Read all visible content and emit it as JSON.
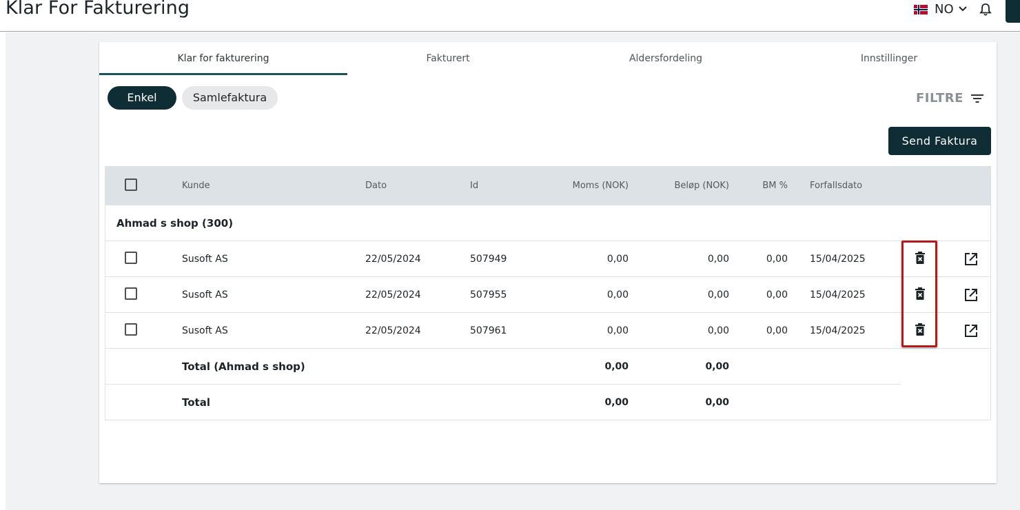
{
  "header": {
    "title": "Klar For Fakturering",
    "language_code": "NO",
    "language_flag": "norway-flag"
  },
  "tabs": [
    {
      "label": "Klar for fakturering",
      "active": true
    },
    {
      "label": "Fakturert",
      "active": false
    },
    {
      "label": "Aldersfordeling",
      "active": false
    },
    {
      "label": "Innstillinger",
      "active": false
    }
  ],
  "mode_toggle": {
    "options": [
      "Enkel",
      "Samlefaktura"
    ],
    "selected": "Enkel"
  },
  "filter": {
    "label": "FILTRE"
  },
  "actions": {
    "send_label": "Send Faktura"
  },
  "table": {
    "columns": [
      "Kunde",
      "Dato",
      "Id",
      "Moms (NOK)",
      "Beløp (NOK)",
      "BM %",
      "Forfallsdato"
    ],
    "group": {
      "title": "Ahmad s shop (300)",
      "rows": [
        {
          "kunde": "Susoft AS",
          "dato": "22/05/2024",
          "id": "507949",
          "moms": "0,00",
          "belop": "0,00",
          "bm": "0,00",
          "forfall": "15/04/2025"
        },
        {
          "kunde": "Susoft AS",
          "dato": "22/05/2024",
          "id": "507955",
          "moms": "0,00",
          "belop": "0,00",
          "bm": "0,00",
          "forfall": "15/04/2025"
        },
        {
          "kunde": "Susoft AS",
          "dato": "22/05/2024",
          "id": "507961",
          "moms": "0,00",
          "belop": "0,00",
          "bm": "0,00",
          "forfall": "15/04/2025"
        }
      ],
      "subtotal": {
        "label": "Total (Ahmad s shop)",
        "moms": "0,00",
        "belop": "0,00"
      }
    },
    "total": {
      "label": "Total",
      "moms": "0,00",
      "belop": "0,00"
    }
  },
  "colors": {
    "primary": "#0f2d35",
    "tab_underline": "#1e4f5c",
    "header_bg": "#dde2e6",
    "highlight": "#b01c1c",
    "canvas": "#f1f2f3"
  }
}
